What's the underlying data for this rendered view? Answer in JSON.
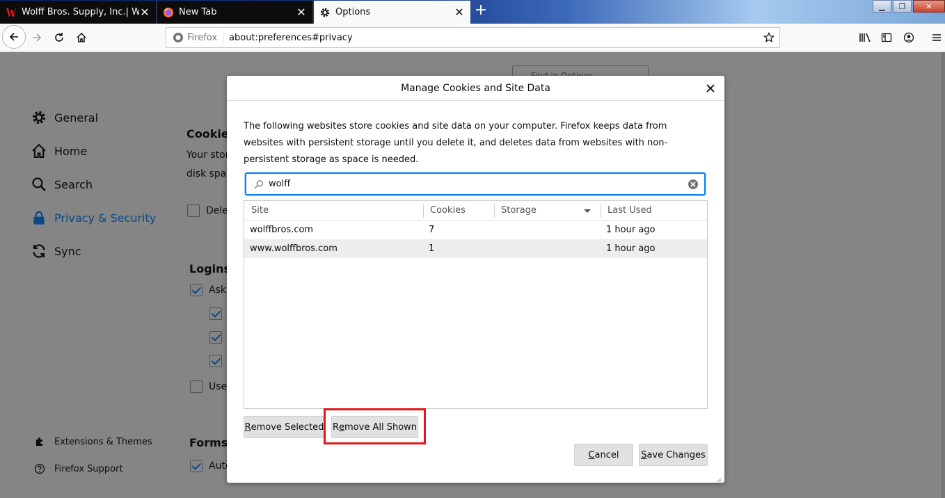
{
  "tabs": [
    {
      "title": "Wolff Bros. Supply, Inc.| Wolff",
      "icon": "wolff-logo-icon",
      "active": false
    },
    {
      "title": "New Tab",
      "icon": "firefox-icon",
      "active": false
    },
    {
      "title": "Options",
      "icon": "gear-icon",
      "active": true
    }
  ],
  "navbar": {
    "identity_label": "Firefox",
    "url": "about:preferences#privacy"
  },
  "preferences": {
    "find_placeholder": "Find in Options",
    "categories": [
      {
        "label": "General",
        "icon": "gear-icon"
      },
      {
        "label": "Home",
        "icon": "home-icon"
      },
      {
        "label": "Search",
        "icon": "search-icon"
      },
      {
        "label": "Privacy & Security",
        "icon": "lock-icon",
        "selected": true
      },
      {
        "label": "Sync",
        "icon": "sync-icon"
      }
    ],
    "footer_links": [
      {
        "label": "Extensions & Themes",
        "icon": "puzzle-icon"
      },
      {
        "label": "Firefox Support",
        "icon": "help-icon"
      }
    ],
    "cookies_heading": "Cookies",
    "cookies_text_1": "Your stor",
    "cookies_text_2": "disk spac",
    "delete_label": "Dele",
    "logins_heading": "Logins",
    "ask_label": "Ask",
    "use_label": "Use",
    "forms_heading": "Forms a",
    "auto_label": "Auto"
  },
  "dialog": {
    "title": "Manage Cookies and Site Data",
    "description": "The following websites store cookies and site data on your computer. Firefox keeps data from websites with persistent storage until you delete it, and deletes data from websites with non-persistent storage as space is needed.",
    "search_value": "wolff",
    "columns": [
      "Site",
      "Cookies",
      "Storage",
      "Last Used"
    ],
    "rows": [
      {
        "site": "wolffbros.com",
        "cookies": "7",
        "storage": "",
        "last_used": "1 hour ago"
      },
      {
        "site": "www.wolffbros.com",
        "cookies": "1",
        "storage": "",
        "last_used": "1 hour ago"
      }
    ],
    "remove_selected": {
      "accel": "R",
      "rest": "emove Selected"
    },
    "remove_all_shown": {
      "pre": "R",
      "accel": "e",
      "rest": "move All Shown"
    },
    "cancel": {
      "accel": "C",
      "rest": "ancel"
    },
    "save_changes": {
      "accel": "S",
      "rest": "ave Changes"
    }
  },
  "colors": {
    "accent": "#0a84ff",
    "highlight": "#e4141b"
  }
}
